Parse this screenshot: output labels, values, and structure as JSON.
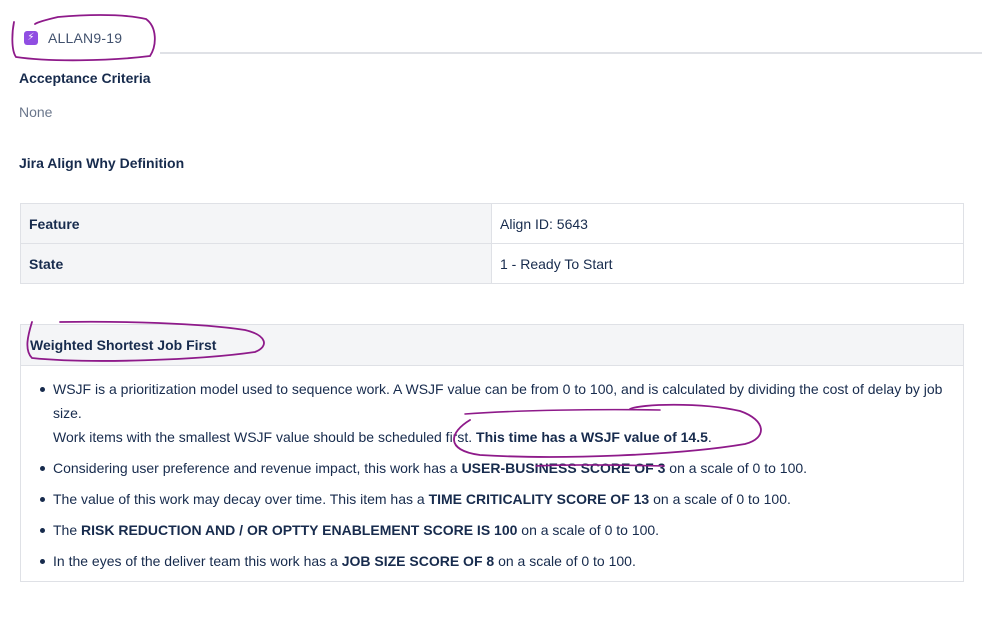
{
  "issue": {
    "key": "ALLAN9-19",
    "type_icon": "lightning-icon",
    "type_color": "#904ee2"
  },
  "acceptance_criteria": {
    "heading": "Acceptance Criteria",
    "value": "None"
  },
  "why_definition": {
    "heading": "Jira Align Why Definition",
    "rows": [
      {
        "label": "Feature",
        "value": "Align ID: 5643"
      },
      {
        "label": "State",
        "value": "1 - Ready To Start"
      }
    ]
  },
  "wsjf": {
    "heading": "Weighted Shortest Job First",
    "item1": {
      "text_a": "WSJF is a prioritization model used to sequence work. A WSJF value can be from 0 to 100, and is calculated by dividing the cost of delay by job size.",
      "text_b": "Work items with the smallest WSJF value should be scheduled first. ",
      "bold": "This time has a WSJF value of 14.5",
      "after": "."
    },
    "item2": {
      "pre": "Considering user preference and revenue impact, this work has a ",
      "bold": "USER-BUSINESS SCORE OF 3",
      "post": " on a scale of 0 to 100."
    },
    "item3": {
      "pre": "The value of this work may decay over time. This item has a ",
      "bold": "TIME CRITICALITY SCORE OF 13",
      "post": " on a scale of 0 to 100."
    },
    "item4": {
      "pre": "The ",
      "bold": "RISK REDUCTION AND / OR OPTTY ENABLEMENT SCORE IS 100",
      "post": " on a scale of 0 to 100."
    },
    "item5": {
      "pre": "In the eyes of the deliver team this work has a ",
      "bold": "JOB SIZE SCORE OF 8",
      "post": " on a scale of 0 to 100."
    }
  },
  "annotation_color": "#8e1a8a"
}
